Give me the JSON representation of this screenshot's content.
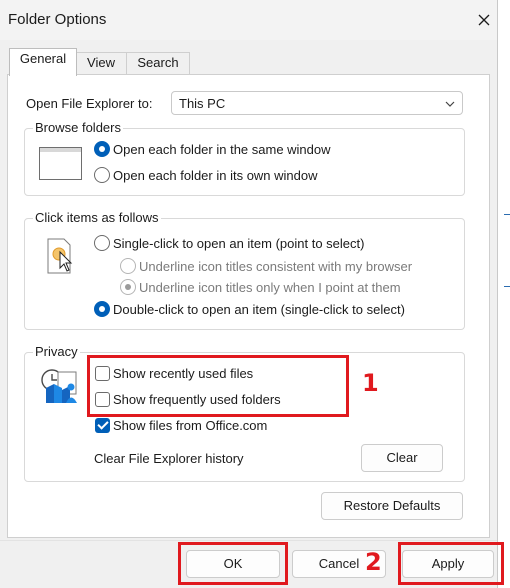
{
  "window": {
    "title": "Folder Options",
    "close_icon": "close-icon"
  },
  "tabs": [
    {
      "label": "General",
      "active": true
    },
    {
      "label": "View",
      "active": false
    },
    {
      "label": "Search",
      "active": false
    }
  ],
  "general": {
    "open_label": "Open File Explorer to:",
    "open_value": "This PC",
    "browse": {
      "legend": "Browse folders",
      "icon": "folder-window-icon",
      "options": [
        {
          "label": "Open each folder in the same window",
          "selected": true
        },
        {
          "label": "Open each folder in its own window",
          "selected": false
        }
      ]
    },
    "click": {
      "legend": "Click items as follows",
      "icon": "pointer-click-icon",
      "single": {
        "label": "Single-click to open an item (point to select)",
        "selected": false
      },
      "sub_options": [
        {
          "label": "Underline icon titles consistent with my browser",
          "selected": false,
          "disabled": true
        },
        {
          "label": "Underline icon titles only when I point at them",
          "selected": true,
          "disabled": true
        }
      ],
      "double": {
        "label": "Double-click to open an item (single-click to select)",
        "selected": true
      }
    },
    "privacy": {
      "legend": "Privacy",
      "icon": "privacy-history-icon",
      "checks": [
        {
          "label": "Show recently used files",
          "checked": false
        },
        {
          "label": "Show frequently used folders",
          "checked": false
        },
        {
          "label": "Show files from Office.com",
          "checked": true
        }
      ],
      "clear_label": "Clear File Explorer history",
      "clear_button": "Clear"
    },
    "restore_button": "Restore Defaults"
  },
  "footer": {
    "ok": "OK",
    "cancel": "Cancel",
    "apply": "Apply"
  },
  "annotations": {
    "marker_1": "1",
    "marker_2": "2",
    "highlight_color": "#e0191e"
  },
  "colors": {
    "accent": "#005fb8"
  }
}
